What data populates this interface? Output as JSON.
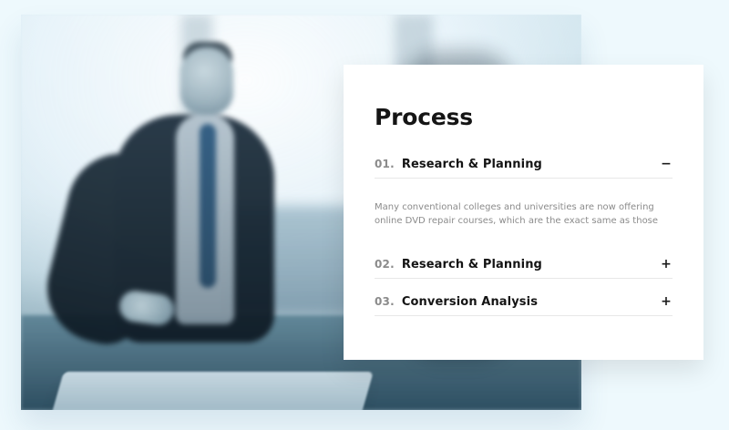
{
  "section": {
    "title": "Process"
  },
  "accordion": {
    "items": [
      {
        "number": "01.",
        "title": "Research & Planning",
        "toggle": "−",
        "expanded": true,
        "body": "Many conventional colleges and universities are now offering online DVD repair courses, which are the exact same as those"
      },
      {
        "number": "02.",
        "title": "Research & Planning",
        "toggle": "+",
        "expanded": false,
        "body": ""
      },
      {
        "number": "03.",
        "title": "Conversion Analysis",
        "toggle": "+",
        "expanded": false,
        "body": ""
      }
    ]
  },
  "colors": {
    "page_background": "#eef9fd",
    "card_background": "#ffffff",
    "title": "#151515",
    "muted": "#8b8b8b",
    "divider": "#e7e7e7"
  }
}
